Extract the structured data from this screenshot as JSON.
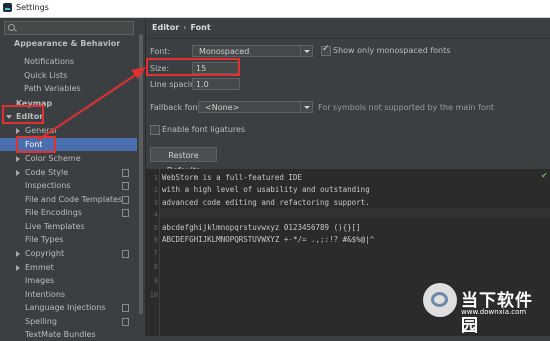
{
  "window": {
    "title": "Settings"
  },
  "search": {
    "placeholder": ""
  },
  "sidebar": {
    "items": [
      {
        "label": "Appearance & Behavior"
      },
      {
        "label": "Notifications"
      },
      {
        "label": "Quick Lists"
      },
      {
        "label": "Path Variables"
      },
      {
        "label": "Keymap"
      },
      {
        "label": "Editor"
      },
      {
        "label": "General"
      },
      {
        "label": "Font"
      },
      {
        "label": "Color Scheme"
      },
      {
        "label": "Code Style"
      },
      {
        "label": "Inspections"
      },
      {
        "label": "File and Code Templates"
      },
      {
        "label": "File Encodings"
      },
      {
        "label": "Live Templates"
      },
      {
        "label": "File Types"
      },
      {
        "label": "Copyright"
      },
      {
        "label": "Emmet"
      },
      {
        "label": "Images"
      },
      {
        "label": "Intentions"
      },
      {
        "label": "Language Injections"
      },
      {
        "label": "Spelling"
      },
      {
        "label": "TextMate Bundles"
      }
    ]
  },
  "breadcrumb": {
    "parent": "Editor",
    "separator": "›",
    "current": "Font"
  },
  "font": {
    "font_label": "Font:",
    "font_value": "Monospaced",
    "monospaced_only_label": "Show only monospaced fonts",
    "monospaced_only_checked": true,
    "size_label": "Size:",
    "size_value": "15",
    "line_spacing_label": "Line spacing:",
    "line_spacing_value": "1.0",
    "fallback_label": "Fallback font:",
    "fallback_value": "<None>",
    "fallback_hint": "For symbols not supported by the main font",
    "ligatures_label": "Enable font ligatures",
    "ligatures_checked": false,
    "restore_button": "Restore Defaults"
  },
  "preview": {
    "lines": [
      {
        "num": "1",
        "text": "WebStorm is a full-featured IDE"
      },
      {
        "num": "2",
        "text": "with a high level of usability and outstanding"
      },
      {
        "num": "3",
        "text": "advanced code editing and refactoring support."
      },
      {
        "num": "4",
        "text": ""
      },
      {
        "num": "5",
        "text": "abcdefghijklmnopqrstuvwxyz 0123456789 (){}[]"
      },
      {
        "num": "6",
        "text": "ABCDEFGHIJKLMNOPQRSTUVWXYZ +-*/= .,;:!? #&$%@|^"
      },
      {
        "num": "7",
        "text": ""
      },
      {
        "num": "8",
        "text": ""
      },
      {
        "num": "9",
        "text": ""
      },
      {
        "num": "10",
        "text": ""
      }
    ]
  },
  "watermark": {
    "name": "当下软件园",
    "url": "www.downxia.com"
  },
  "colors": {
    "accent_selected": "#4b6eaf",
    "annotation": "#e03030",
    "background": "#3c3f41",
    "editor_bg": "#2b2b2b"
  }
}
